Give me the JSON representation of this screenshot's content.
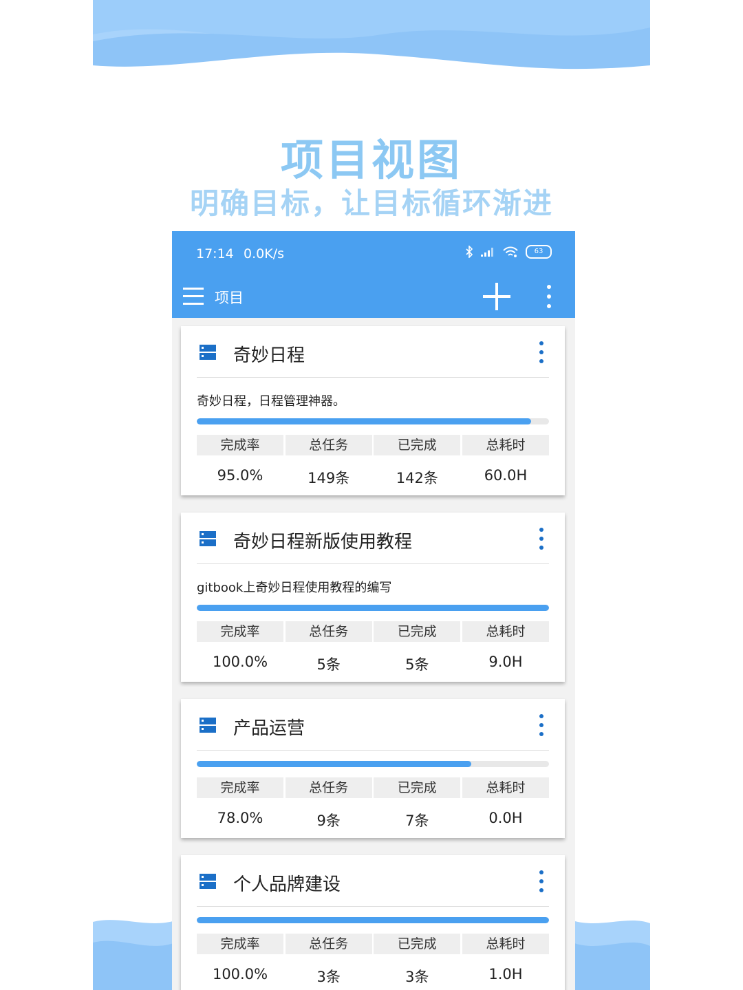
{
  "promo": {
    "title": "项目视图",
    "subtitle": "明确目标，让目标循环渐进"
  },
  "statusbar": {
    "time": "17:14",
    "speed": "0.0K/s",
    "battery": "63",
    "icons": [
      "bluetooth-icon",
      "signal-icon",
      "wifi-icon",
      "battery-icon"
    ]
  },
  "appbar": {
    "title": "项目",
    "icons": [
      "menu-icon",
      "add-icon",
      "more-vert-icon"
    ]
  },
  "colors": {
    "accent": "#4aa0f0",
    "icon_blue": "#1b6fc7",
    "promo_text": "#8cc8f3"
  },
  "stat_labels": [
    "完成率",
    "总任务",
    "已完成",
    "总耗时"
  ],
  "projects": [
    {
      "title": "奇妙日程",
      "description": "奇妙日程，日程管理神器。",
      "progress": 0.95,
      "completion_rate": "95.0%",
      "total_tasks": "149条",
      "completed": "142条",
      "total_time": "60.0H"
    },
    {
      "title": "奇妙日程新版使用教程",
      "description": "gitbook上奇妙日程使用教程的编写",
      "progress": 1.0,
      "completion_rate": "100.0%",
      "total_tasks": "5条",
      "completed": "5条",
      "total_time": "9.0H"
    },
    {
      "title": "产品运营",
      "description": "",
      "progress": 0.78,
      "completion_rate": "78.0%",
      "total_tasks": "9条",
      "completed": "7条",
      "total_time": "0.0H"
    },
    {
      "title": "个人品牌建设",
      "description": "",
      "progress": 1.0,
      "completion_rate": "100.0%",
      "total_tasks": "3条",
      "completed": "3条",
      "total_time": "1.0H"
    }
  ]
}
